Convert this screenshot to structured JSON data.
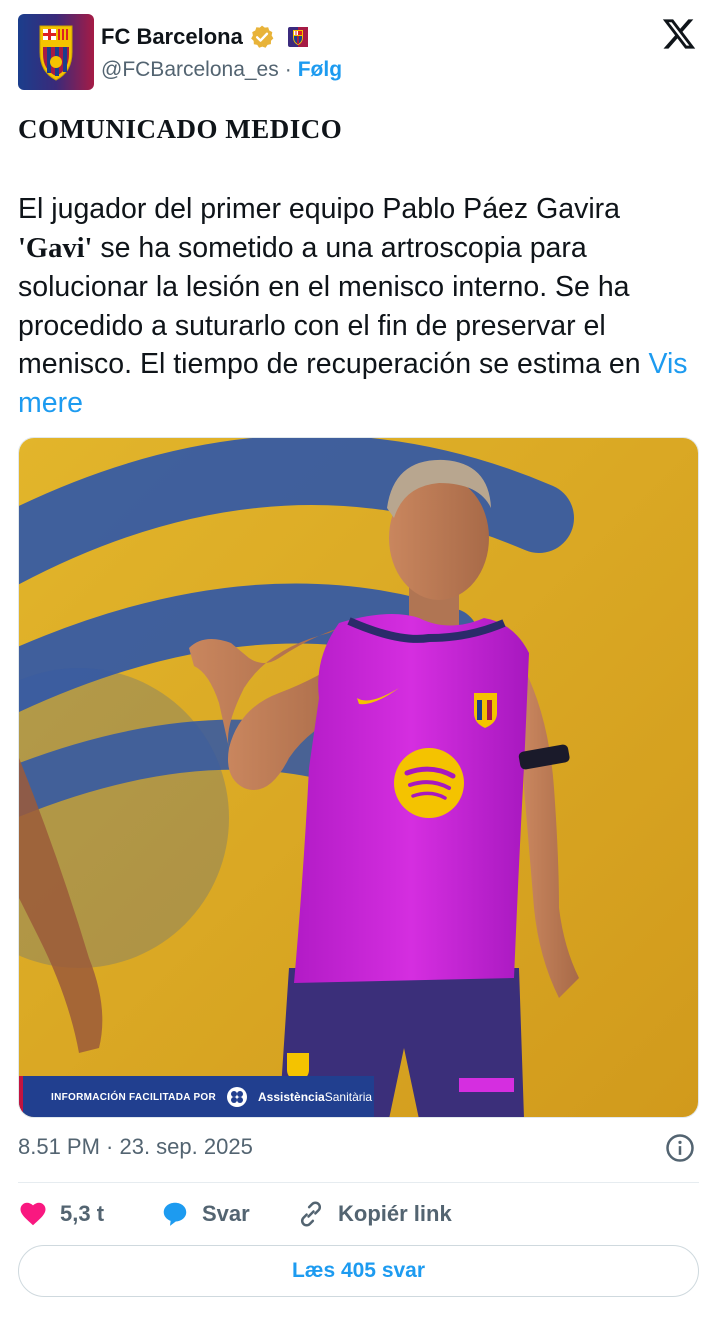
{
  "account": {
    "display_name": "FC Barcelona",
    "handle": "@FCBarcelona_es",
    "separator": "·",
    "follow_label": "Følg",
    "avatar_icon": "fc-barcelona-crest",
    "verified_icon": "verified-gold-badge",
    "flag_icon": "barcelona-emoji-badge",
    "platform_icon": "x-logo"
  },
  "post": {
    "headline": "COMUNICADO MEDICO",
    "text_line1": "El jugador del primer equipo Pablo Páez Gavira",
    "text_gavi": "'Gavi'",
    "text_rest": " se ha sometido a una artroscopia para solucionar la lesión en el menisco interno. Se ha procedido a suturarlo con el fin de preservar el menisco. El tiempo de recuperación se estima en ",
    "show_more": "Vis mere",
    "media_banner_text": "INFORMACIÓN FACILITADA POR",
    "media_banner_brand_a": "Assistència",
    "media_banner_brand_b": "Sanitària",
    "timestamp": "8.51 PM · 23. sep. 2025"
  },
  "actions": {
    "likes": "5,3 t",
    "reply_label": "Svar",
    "copy_label": "Kopiér link",
    "read_replies_label": "Læs 405 svar"
  },
  "colors": {
    "accent": "#1d9bf0",
    "like": "#f91880",
    "text_secondary": "#536471"
  }
}
